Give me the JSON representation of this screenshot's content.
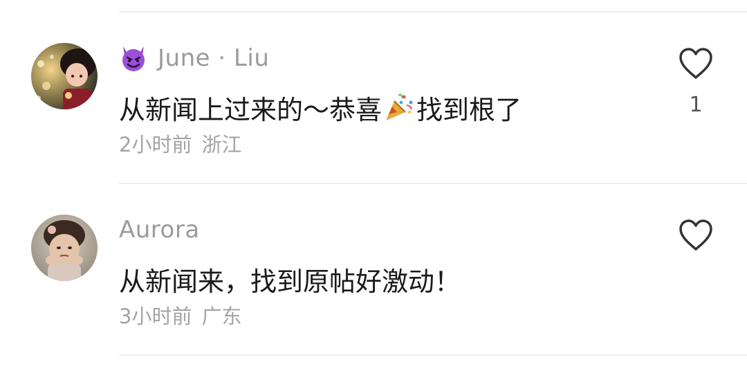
{
  "comments": [
    {
      "username": "June · Liu",
      "name_emoji": "smiling-devil-emoji",
      "text_before": "从新闻上过来的～恭喜",
      "inline_emoji": "party-popper-emoji",
      "text_after": "找到根了",
      "time": "2小时前",
      "location": "浙江",
      "like_count": "1",
      "like_icon": "heart-outline-icon"
    },
    {
      "username": "Aurora",
      "text": "从新闻来，找到原帖好激动！",
      "time": "3小时前",
      "location": "广东",
      "like_icon": "heart-outline-icon"
    }
  ],
  "colors": {
    "username": "#9b9b9b",
    "text": "#1a1a1a",
    "meta": "#a4a4a4",
    "divider": "#ededed",
    "devil_purple": "#8e44c9"
  }
}
